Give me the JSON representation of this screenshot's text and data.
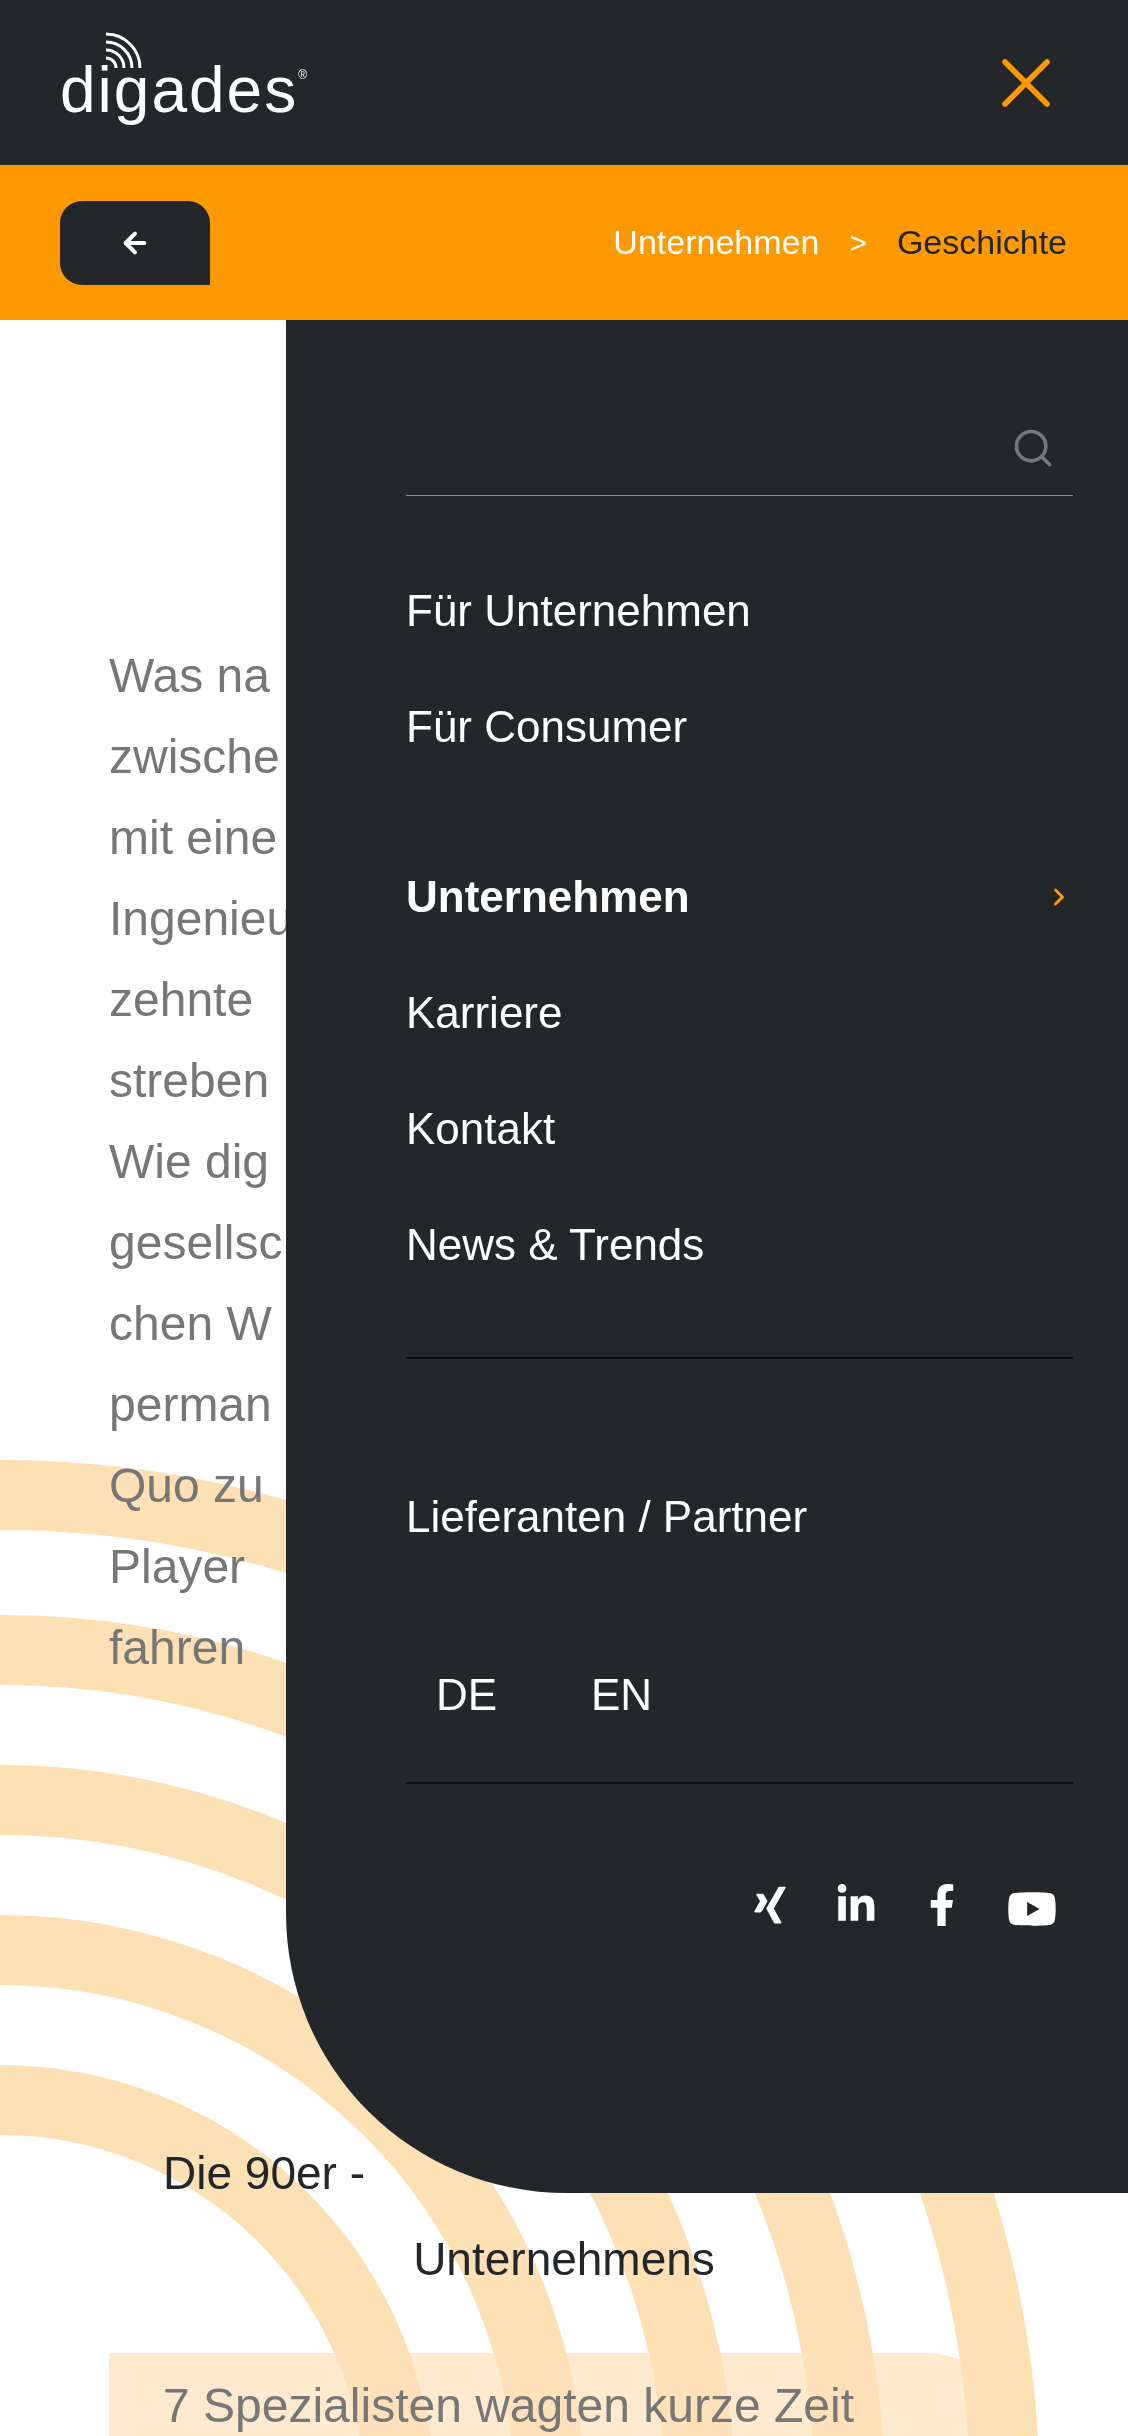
{
  "header": {
    "logo": {
      "text": "digades",
      "mark": "®"
    }
  },
  "subbar": {
    "breadcrumb": [
      {
        "label": "Unternehmen",
        "selected": false
      },
      {
        "label": "Geschichte",
        "selected": true
      }
    ],
    "separator": ">"
  },
  "content": {
    "paragraph_lines": [
      "Was na",
      "zwische",
      "mit eine",
      "Ingenieu",
      "zehnte",
      "streben",
      "Wie dig",
      "gesellsc",
      "chen W",
      "perman",
      "Quo zu",
      "Player",
      "fahren"
    ],
    "heading_lines": [
      "Die 90er -",
      "Unternehmens"
    ],
    "card_text": "7 Spezialisten wagten kurze Zeit"
  },
  "menu": {
    "primary": [
      {
        "label": "Für Unternehmen",
        "selected": false
      },
      {
        "label": "Für Consumer",
        "selected": false
      }
    ],
    "secondary": [
      {
        "label": "Unternehmen",
        "selected": true
      },
      {
        "label": "Karriere",
        "selected": false
      },
      {
        "label": "Kontakt",
        "selected": false
      },
      {
        "label": "News & Trends",
        "selected": false
      }
    ],
    "partner_link": "Lieferanten / Partner",
    "languages": [
      "DE",
      "EN"
    ],
    "social": [
      {
        "kind": "xing"
      },
      {
        "kind": "linkedin"
      },
      {
        "kind": "facebook"
      },
      {
        "kind": "youtube"
      }
    ]
  }
}
